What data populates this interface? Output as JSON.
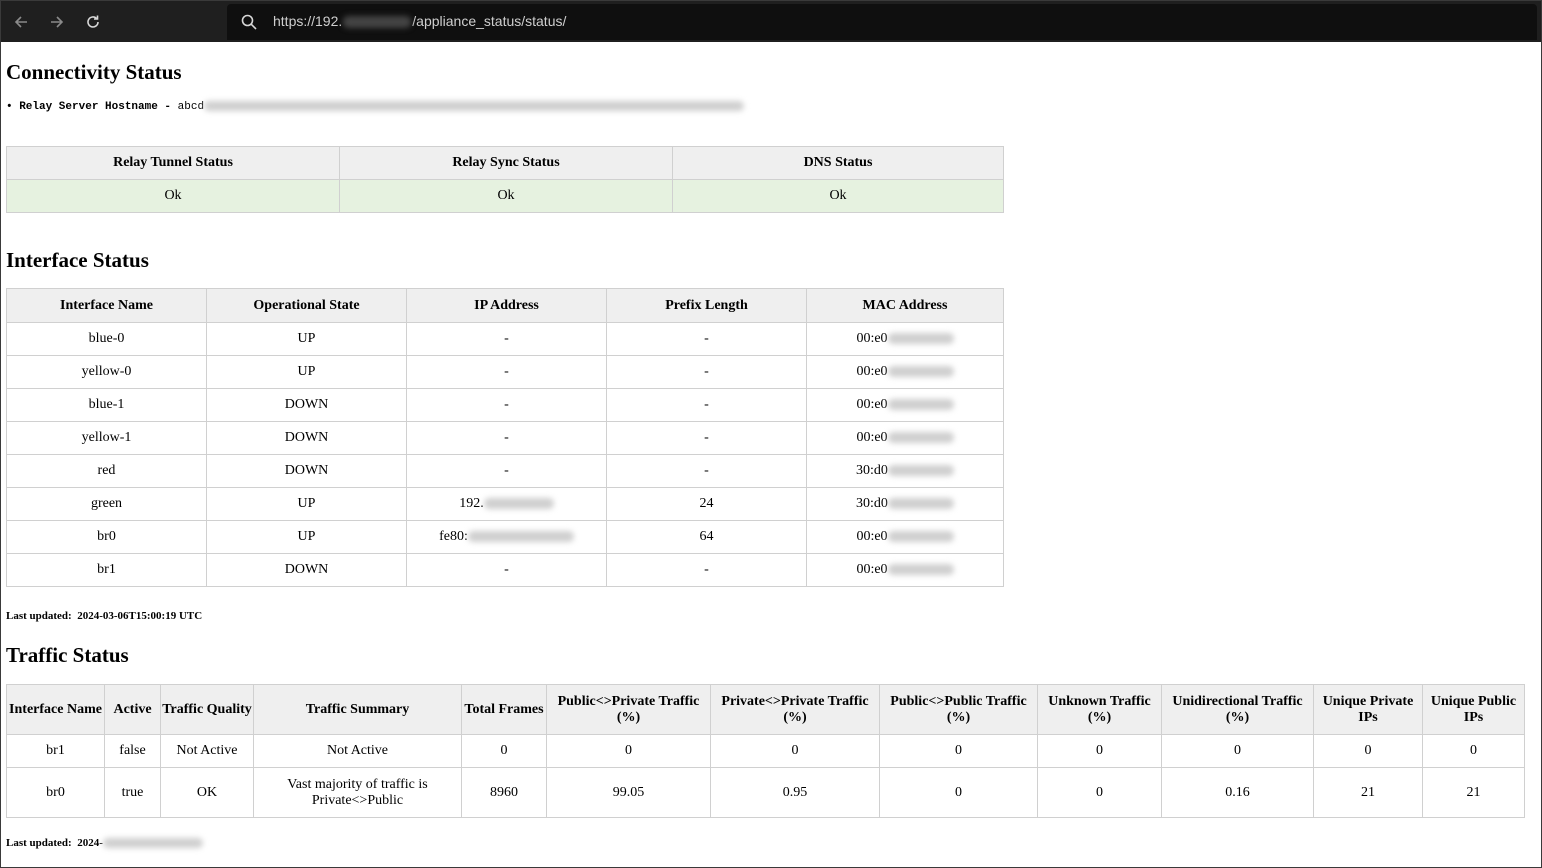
{
  "browser": {
    "url_prefix": "https://192.",
    "url_suffix": "/appliance_status/status/"
  },
  "connectivity": {
    "title": "Connectivity Status",
    "host_label": "• Relay Server Hostname - ",
    "host_value": "abcd",
    "headers": [
      "Relay Tunnel Status",
      "Relay Sync Status",
      "DNS Status"
    ],
    "values": [
      "Ok",
      "Ok",
      "Ok"
    ]
  },
  "interface": {
    "title": "Interface Status",
    "headers": [
      "Interface Name",
      "Operational State",
      "IP Address",
      "Prefix Length",
      "MAC Address"
    ],
    "rows": [
      [
        "blue-0",
        "UP",
        "-",
        "-",
        "00:e0"
      ],
      [
        "yellow-0",
        "UP",
        "-",
        "-",
        "00:e0"
      ],
      [
        "blue-1",
        "DOWN",
        "-",
        "-",
        "00:e0"
      ],
      [
        "yellow-1",
        "DOWN",
        "-",
        "-",
        "00:e0"
      ],
      [
        "red",
        "DOWN",
        "-",
        "-",
        "30:d0"
      ],
      [
        "green",
        "UP",
        "192.",
        "24",
        "30:d0"
      ],
      [
        "br0",
        "UP",
        "fe80:",
        "64",
        "00:e0"
      ],
      [
        "br1",
        "DOWN",
        "-",
        "-",
        "00:e0"
      ]
    ],
    "updated_label": "Last updated:",
    "updated_value": "2024-03-06T15:00:19 UTC"
  },
  "traffic": {
    "title": "Traffic Status",
    "headers": [
      "Interface Name",
      "Active",
      "Traffic Quality",
      "Traffic Summary",
      "Total Frames",
      "Public<>Private Traffic (%)",
      "Private<>Private Traffic (%)",
      "Public<>Public Traffic (%)",
      "Unknown Traffic (%)",
      "Unidirectional Traffic (%)",
      "Unique Private IPs",
      "Unique Public IPs"
    ],
    "rows": [
      [
        "br1",
        "false",
        "Not Active",
        "Not Active",
        "0",
        "0",
        "0",
        "0",
        "0",
        "0",
        "0",
        "0"
      ],
      [
        "br0",
        "true",
        "OK",
        "Vast majority of traffic is Private<>Public",
        "8960",
        "99.05",
        "0.95",
        "0",
        "0",
        "0.16",
        "21",
        "21"
      ]
    ],
    "updated_label": "Last updated:",
    "updated_value": "2024-"
  }
}
